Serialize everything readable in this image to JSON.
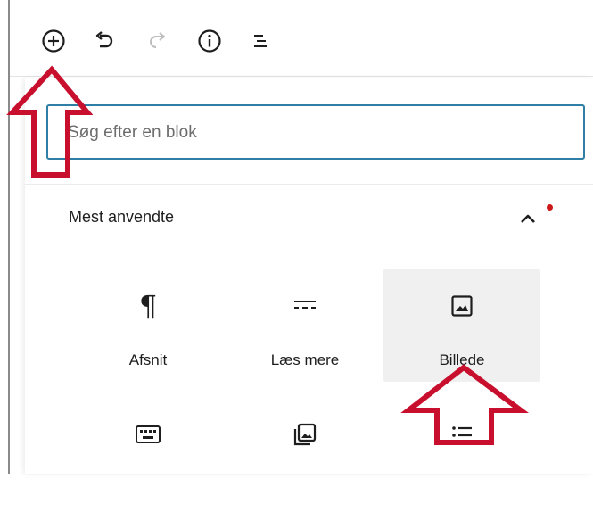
{
  "toolbar": {
    "buttons": [
      {
        "name": "add-block-button",
        "icon": "plus-circle-icon"
      },
      {
        "name": "undo-button",
        "icon": "undo-icon"
      },
      {
        "name": "redo-button",
        "icon": "redo-icon",
        "disabled": true
      },
      {
        "name": "details-button",
        "icon": "info-icon"
      },
      {
        "name": "list-view-button",
        "icon": "list-view-icon"
      }
    ]
  },
  "inserter": {
    "search": {
      "placeholder": "Søg efter en blok",
      "value": ""
    },
    "section": {
      "title": "Mest anvendte",
      "expanded": true,
      "has_notice": true
    },
    "blocks": [
      {
        "label": "Afsnit",
        "icon": "paragraph-icon"
      },
      {
        "label": "Læs mere",
        "icon": "more-icon"
      },
      {
        "label": "Billede",
        "icon": "image-icon",
        "highlighted": true
      },
      {
        "label": "",
        "icon": "keyboard-icon"
      },
      {
        "label": "",
        "icon": "gallery-icon"
      },
      {
        "label": "",
        "icon": "list-icon"
      }
    ]
  },
  "annotations": {
    "arrow_color": "#c8102e",
    "arrows": [
      {
        "points_to": "add-block-button",
        "direction": "up"
      },
      {
        "points_to": "Billede",
        "direction": "up"
      }
    ]
  },
  "colors": {
    "focus_border": "#2e7ea6",
    "highlight_bg": "#f0f0f0",
    "notice_dot": "#cc1818",
    "disabled_icon": "#bdbdbd"
  }
}
